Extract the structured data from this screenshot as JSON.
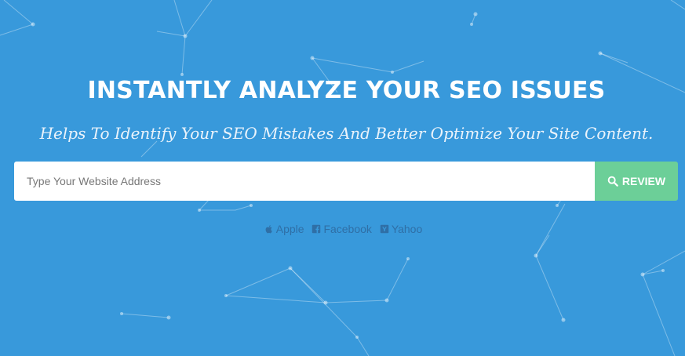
{
  "hero": {
    "headline": "INSTANTLY ANALYZE YOUR SEO ISSUES",
    "subheadline": "Helps To Identify Your SEO Mistakes And Better Optimize Your Site Content."
  },
  "search": {
    "placeholder": "Type Your Website Address",
    "value": "",
    "button_label": "REVIEW",
    "button_icon": "search-icon"
  },
  "examples": [
    {
      "label": "Apple",
      "icon": "apple-icon"
    },
    {
      "label": "Facebook",
      "icon": "facebook-icon"
    },
    {
      "label": "Yahoo",
      "icon": "yahoo-icon"
    }
  ],
  "colors": {
    "background": "#3899db",
    "button": "#6ccf98",
    "example_links": "#2f6fa6",
    "headline": "#ffffff"
  }
}
